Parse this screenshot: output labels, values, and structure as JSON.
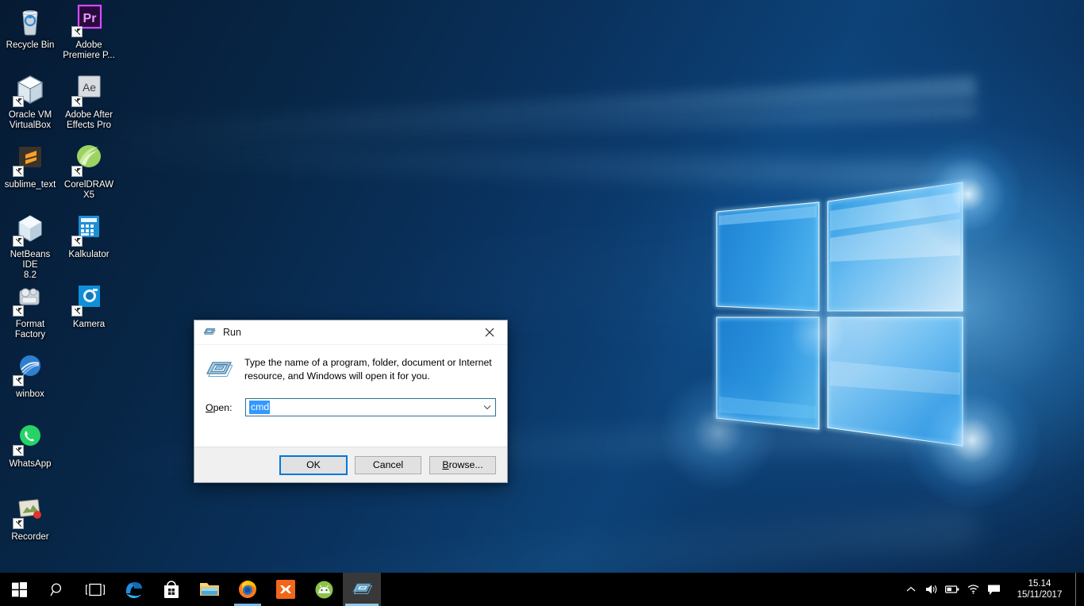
{
  "desktop": {
    "wallpaper_name": "windows-10-hero-wallpaper",
    "colors": {
      "bg_dark": "#061d38",
      "bg_mid": "#0d4377",
      "glow": "#8fd4ff",
      "taskbar": "#000000",
      "accent": "#0078d7"
    },
    "icons": [
      {
        "name": "recycle-bin",
        "label": "Recycle Bin",
        "icon": "recycle-bin-icon",
        "shortcut": false,
        "col": 0,
        "row": 0
      },
      {
        "name": "adobe-premiere-pro",
        "label": "Adobe\nPremiere P...",
        "icon": "premiere-pro-icon",
        "shortcut": true,
        "col": 1,
        "row": 0
      },
      {
        "name": "oracle-vm-virtualbox",
        "label": "Oracle VM\nVirtualBox",
        "icon": "virtualbox-icon",
        "shortcut": true,
        "col": 0,
        "row": 1
      },
      {
        "name": "adobe-after-effects",
        "label": "Adobe After\nEffects Pro",
        "icon": "after-effects-icon",
        "shortcut": true,
        "col": 1,
        "row": 1
      },
      {
        "name": "sublime-text",
        "label": "sublime_text",
        "icon": "sublime-text-icon",
        "shortcut": true,
        "col": 0,
        "row": 2
      },
      {
        "name": "coreldraw-x5",
        "label": "CorelDRAW\nX5",
        "icon": "coreldraw-icon",
        "shortcut": true,
        "col": 1,
        "row": 2
      },
      {
        "name": "netbeans-ide",
        "label": "NetBeans IDE\n8.2",
        "icon": "netbeans-icon",
        "shortcut": true,
        "col": 0,
        "row": 3
      },
      {
        "name": "kalkulator",
        "label": "Kalkulator",
        "icon": "calculator-icon",
        "shortcut": true,
        "col": 1,
        "row": 3
      },
      {
        "name": "format-factory",
        "label": "Format\nFactory",
        "icon": "format-factory-icon",
        "shortcut": true,
        "col": 0,
        "row": 4
      },
      {
        "name": "kamera",
        "label": "Kamera",
        "icon": "camera-icon",
        "shortcut": true,
        "col": 1,
        "row": 4
      },
      {
        "name": "winbox",
        "label": "winbox",
        "icon": "winbox-icon",
        "shortcut": true,
        "col": 0,
        "row": 5
      },
      {
        "name": "whatsapp",
        "label": "WhatsApp",
        "icon": "whatsapp-icon",
        "shortcut": true,
        "col": 0,
        "row": 6
      },
      {
        "name": "recorder",
        "label": "Recorder",
        "icon": "recorder-icon",
        "shortcut": true,
        "col": 0,
        "row": 7
      }
    ]
  },
  "run_dialog": {
    "title": "Run",
    "title_icon": "run-window-icon",
    "close_label": "✕",
    "prompt": "Type the name of a program, folder, document or Internet resource, and Windows will open it for you.",
    "open_label_prefix": "O",
    "open_label_rest": "pen:",
    "open_value": "cmd",
    "open_value_selected": true,
    "dropdown_caret": "chevron-down-icon",
    "buttons": [
      {
        "name": "ok-button",
        "label": "OK",
        "default": true,
        "accel": ""
      },
      {
        "name": "cancel-button",
        "label": "Cancel",
        "default": false,
        "accel": ""
      },
      {
        "name": "browse-button",
        "label_prefix": "B",
        "label_rest": "rowse...",
        "label": "Browse...",
        "default": false,
        "accel": "B"
      }
    ]
  },
  "taskbar": {
    "start": {
      "name": "start-button",
      "icon": "windows-logo-icon",
      "label": "Start"
    },
    "search": {
      "name": "search-button",
      "icon": "search-icon",
      "label": "Search"
    },
    "taskview": {
      "name": "task-view-button",
      "icon": "task-view-icon",
      "label": "Task View"
    },
    "apps": [
      {
        "name": "microsoft-edge",
        "icon": "edge-icon",
        "label": "Microsoft Edge",
        "state": "pinned"
      },
      {
        "name": "microsoft-store",
        "icon": "store-icon",
        "label": "Microsoft Store",
        "state": "pinned"
      },
      {
        "name": "file-explorer",
        "icon": "file-explorer-icon",
        "label": "File Explorer",
        "state": "pinned"
      },
      {
        "name": "mozilla-firefox",
        "icon": "firefox-icon",
        "label": "Mozilla Firefox",
        "state": "running"
      },
      {
        "name": "xampp",
        "icon": "xampp-icon",
        "label": "XAMPP",
        "state": "pinned"
      },
      {
        "name": "android-studio",
        "icon": "android-studio-icon",
        "label": "Android Studio",
        "state": "pinned"
      },
      {
        "name": "run-window",
        "icon": "run-window-icon",
        "label": "Run",
        "state": "active"
      }
    ],
    "tray": [
      {
        "name": "show-hidden-icons",
        "icon": "chevron-up-icon"
      },
      {
        "name": "volume",
        "icon": "speaker-icon"
      },
      {
        "name": "battery",
        "icon": "battery-icon"
      },
      {
        "name": "network",
        "icon": "wifi-icon"
      },
      {
        "name": "action-center",
        "icon": "speech-bubble-icon"
      }
    ],
    "clock": {
      "time": "15.14",
      "date": "15/11/2017"
    },
    "show_desktop": {
      "name": "show-desktop-button",
      "label": "Show desktop"
    }
  }
}
